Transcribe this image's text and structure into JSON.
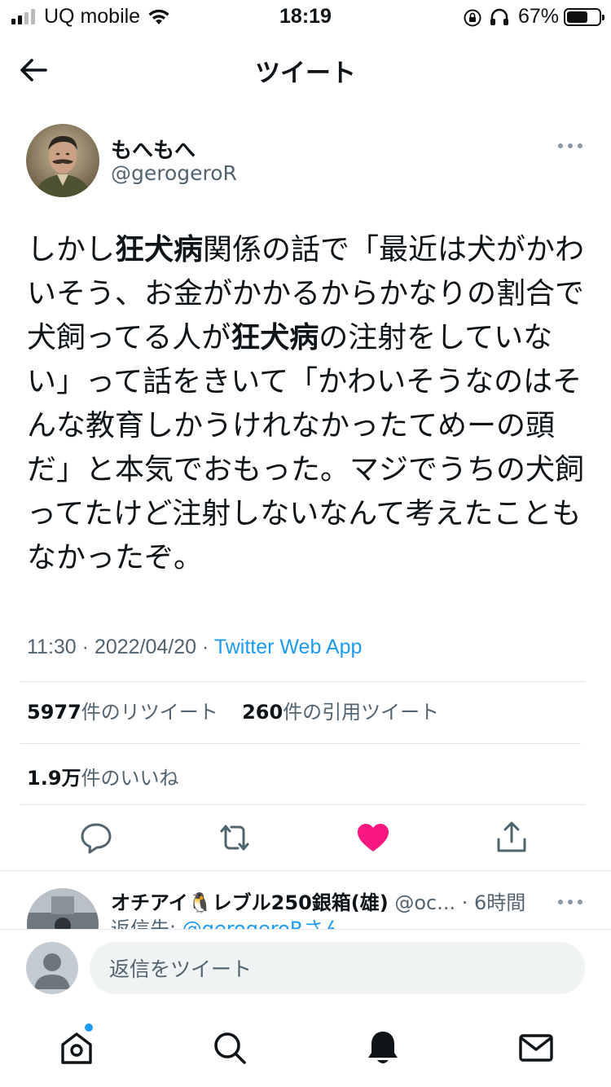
{
  "status_bar": {
    "carrier": "UQ mobile",
    "time": "18:19",
    "battery_percent": "67%",
    "battery_level": 0.67
  },
  "header": {
    "title": "ツイート",
    "back_icon": "arrow-left-icon"
  },
  "tweet": {
    "author_name": "もへもへ",
    "author_handle": "@gerogeroR",
    "body_segments": [
      "しかし",
      "狂犬病",
      "関係の話で「最近は犬がかわいそう、お金がかかるからかなりの割合で犬飼ってる人が",
      "狂犬病",
      "の注射をしていない」って話をきいて「かわいそうなのはそんな教育しかうけれなかったてめーの頭だ」と本気でおもった。マジでうちの犬飼ってたけど注射しないなんて考えたこともなかったぞ。"
    ],
    "time": "11:30",
    "date": "2022/04/20",
    "separator": " · ",
    "source": "Twitter Web App",
    "retweet_count": "5977",
    "retweet_label": "件のリツイート",
    "quote_count": "260",
    "quote_label": "件の引用ツイート",
    "like_count": "1.9万",
    "like_label": "件のいいね",
    "liked": true,
    "colors": {
      "like": "#f91880",
      "link": "#1d9bf0",
      "secondary_text": "#536471"
    }
  },
  "reply_preview": {
    "name": "オチアイ🐧レブル250銀箱(雄)",
    "handle": "@oc...",
    "time": "· 6時間",
    "reply_to_label": "返信先: ",
    "reply_to_link": "@gerogeroRさん"
  },
  "composer": {
    "placeholder": "返信をツイート"
  },
  "tabbar": {
    "items": [
      "home-icon",
      "search-icon",
      "notifications-icon",
      "messages-icon"
    ]
  }
}
